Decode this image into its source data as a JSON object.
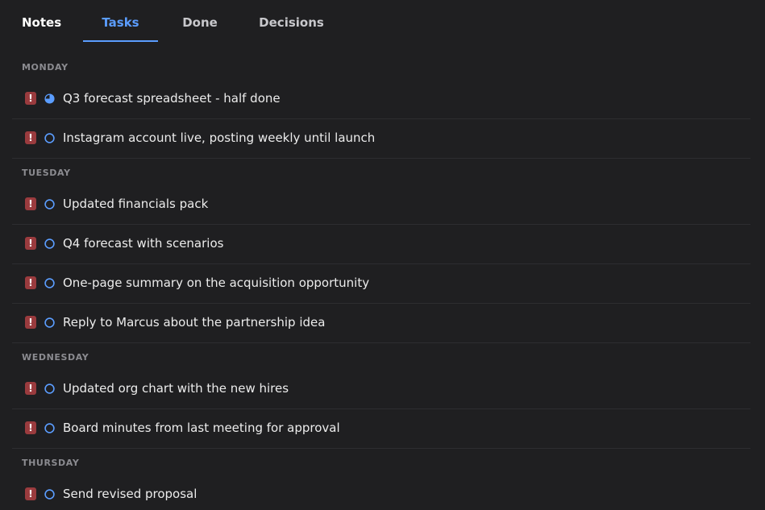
{
  "tabs": {
    "notes": "Notes",
    "tasks": "Tasks",
    "done": "Done",
    "decisions": "Decisions"
  },
  "colors": {
    "background": "#1f1f21",
    "accent": "#5b9dff",
    "priority": "#9a3b3e",
    "day_header": "#8b8b90"
  },
  "priority_icon": "!",
  "days": [
    {
      "name": "MONDAY",
      "tasks": [
        {
          "label": "Q3 forecast spreadsheet - half done",
          "status": "in-progress"
        },
        {
          "label": "Instagram account live, posting weekly until launch",
          "status": "todo"
        }
      ]
    },
    {
      "name": "TUESDAY",
      "tasks": [
        {
          "label": "Updated financials pack",
          "status": "todo"
        },
        {
          "label": "Q4 forecast with scenarios",
          "status": "todo"
        },
        {
          "label": "One-page summary on the acquisition opportunity",
          "status": "todo"
        },
        {
          "label": "Reply to Marcus about the partnership idea",
          "status": "todo"
        }
      ]
    },
    {
      "name": "WEDNESDAY",
      "tasks": [
        {
          "label": "Updated org chart with the new hires",
          "status": "todo"
        },
        {
          "label": "Board minutes from last meeting for approval",
          "status": "todo"
        }
      ]
    },
    {
      "name": "THURSDAY",
      "tasks": [
        {
          "label": "Send revised proposal",
          "status": "todo"
        }
      ]
    }
  ]
}
